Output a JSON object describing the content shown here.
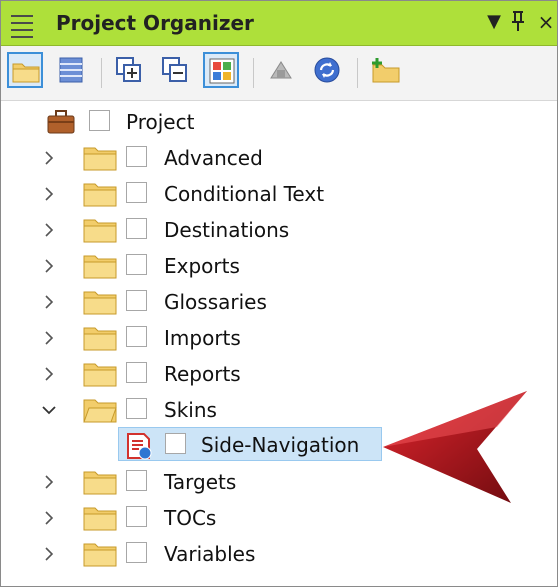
{
  "window": {
    "title": "Project Organizer",
    "controls": {
      "dropdown": "▼",
      "pin": "🖈",
      "close": "×"
    }
  },
  "toolbar": {
    "buttons": [
      {
        "name": "open-folder-icon",
        "selected": true
      },
      {
        "name": "table-view-icon",
        "selected": false
      },
      {
        "name": "expand-all-icon",
        "selected": false
      },
      {
        "name": "collapse-all-icon",
        "selected": false
      },
      {
        "name": "color-grid-icon",
        "selected": true
      },
      {
        "name": "publish-icon",
        "selected": false
      },
      {
        "name": "sync-icon",
        "selected": false
      },
      {
        "name": "new-folder-icon",
        "selected": false
      }
    ]
  },
  "tree": {
    "root": {
      "label": "Project",
      "icon": "briefcase-icon"
    },
    "items": [
      {
        "label": "Advanced",
        "expanded": false
      },
      {
        "label": "Conditional Text",
        "expanded": false
      },
      {
        "label": "Destinations",
        "expanded": false
      },
      {
        "label": "Exports",
        "expanded": false
      },
      {
        "label": "Glossaries",
        "expanded": false
      },
      {
        "label": "Imports",
        "expanded": false
      },
      {
        "label": "Reports",
        "expanded": false
      },
      {
        "label": "Skins",
        "expanded": true
      },
      {
        "label": "Targets",
        "expanded": false
      },
      {
        "label": "TOCs",
        "expanded": false
      },
      {
        "label": "Variables",
        "expanded": false
      }
    ],
    "skins_child": {
      "label": "Side-Navigation",
      "icon": "skin-file-icon",
      "selected": true
    }
  },
  "colors": {
    "titlebar": "#aee03a",
    "selection_bg": "#cce4f7",
    "selection_border": "#99c9ef",
    "arrow": "#c0121a"
  }
}
